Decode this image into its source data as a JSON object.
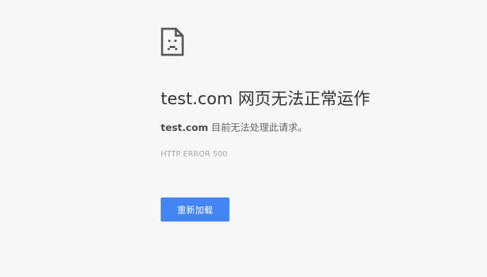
{
  "error": {
    "icon": "sad-page-icon",
    "host": "test.com",
    "title_suffix": "网页无法正常运作",
    "message_suffix": "目前无法处理此请求。",
    "code": "HTTP ERROR 500"
  },
  "actions": {
    "reload_label": "重新加载"
  },
  "colors": {
    "background": "#f7f7f7",
    "button": "#4285f4",
    "heading": "#333333",
    "message": "#646464",
    "code": "#a4a4a4"
  }
}
